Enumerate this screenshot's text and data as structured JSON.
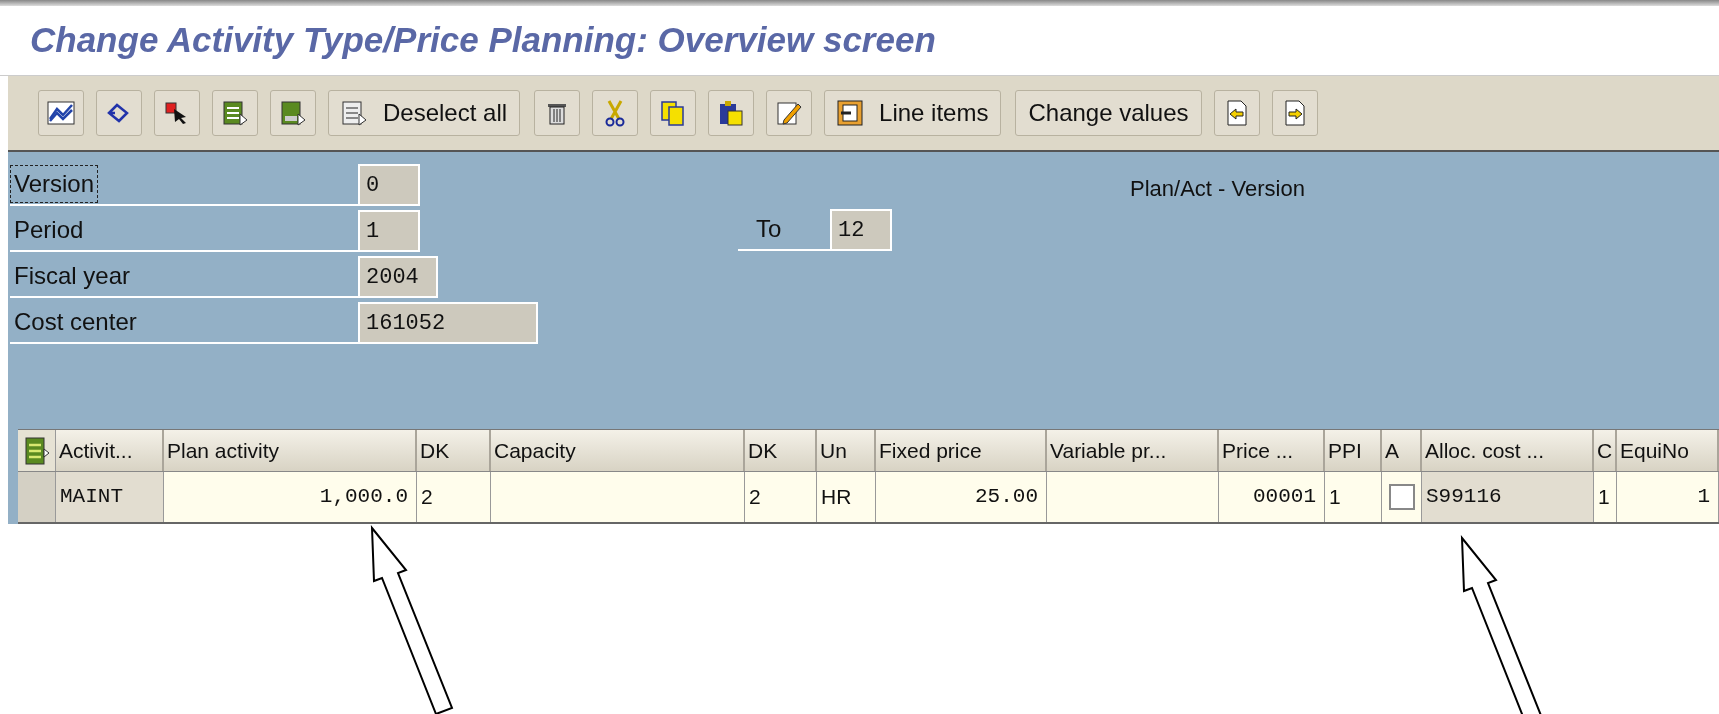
{
  "window": {
    "title": "Change Activity Type/Price Planning: Overview screen"
  },
  "toolbar": [
    {
      "kind": "icon"
    },
    {
      "kind": "icon"
    },
    {
      "kind": "icon"
    },
    {
      "kind": "icon"
    },
    {
      "kind": "icon"
    },
    {
      "kind": "labeled",
      "label": "Deselect all"
    },
    {
      "kind": "icon"
    },
    {
      "kind": "icon"
    },
    {
      "kind": "icon"
    },
    {
      "kind": "icon"
    },
    {
      "kind": "icon"
    },
    {
      "kind": "labeled",
      "label": "Line items"
    },
    {
      "kind": "text",
      "label": "Change values"
    },
    {
      "kind": "icon"
    },
    {
      "kind": "icon"
    }
  ],
  "header": {
    "fields": [
      {
        "label": "Version",
        "value": "0",
        "focused": true
      },
      {
        "label": "Period",
        "value": "1",
        "focused": false
      },
      {
        "label": "Fiscal year",
        "value": "2004",
        "focused": false
      },
      {
        "label": "Cost center",
        "value": "161052",
        "focused": false
      }
    ],
    "period_to": {
      "label": "To",
      "value": "12"
    },
    "version_text": "Plan/Act - Version"
  },
  "table": {
    "columns": [
      "Activit...",
      "Plan activity",
      "DK",
      "Capacity",
      "DK",
      "Un",
      "Fixed price",
      "Variable pr...",
      "Price ...",
      "PPI",
      "A",
      "Alloc. cost ...",
      "C",
      "EquiNo"
    ],
    "rows": [
      {
        "selected": false,
        "cells": [
          {
            "kind": "text",
            "value": "MAINT",
            "editable": false
          },
          {
            "kind": "text",
            "value": "1,000.0",
            "editable": true
          },
          {
            "kind": "text",
            "value": "2",
            "editable": true
          },
          {
            "kind": "text",
            "editable": true
          },
          {
            "kind": "text",
            "value": "2",
            "editable": true
          },
          {
            "kind": "text",
            "value": "HR",
            "editable": true
          },
          {
            "kind": "text",
            "value": "25.00",
            "editable": true
          },
          {
            "kind": "text",
            "editable": true
          },
          {
            "kind": "text",
            "value": "00001",
            "editable": true
          },
          {
            "kind": "text",
            "value": "1",
            "editable": true
          },
          {
            "kind": "checkbox",
            "checked": false,
            "editable": true
          },
          {
            "kind": "text",
            "value": "S99116",
            "editable": false
          },
          {
            "kind": "text",
            "value": "1",
            "editable": true
          },
          {
            "kind": "text",
            "value": "1",
            "editable": true
          }
        ]
      }
    ]
  },
  "annotations": [
    {
      "kind": "arrow"
    },
    {
      "kind": "arrow"
    }
  ]
}
